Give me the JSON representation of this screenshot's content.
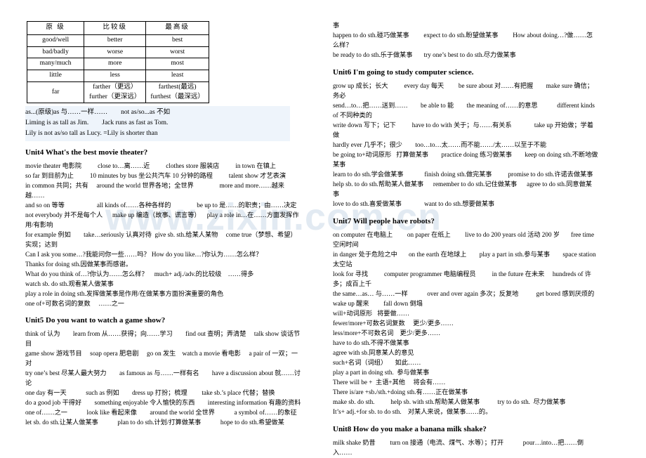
{
  "watermark": {
    "text": "www.zixin.com.cn"
  },
  "grammar_table": {
    "headers": [
      "原 级",
      "比较级",
      "最高级"
    ],
    "rows": [
      [
        "good/well",
        "better",
        "best"
      ],
      [
        "bad/badly",
        "worse",
        "worst"
      ],
      [
        "many/much",
        "more",
        "most"
      ],
      [
        "little",
        "less",
        "least"
      ],
      [
        "far",
        "farther（更远）\nfurther（更深远）",
        "farthest(最远)\nfurthest（最深远）"
      ]
    ]
  },
  "note_block": {
    "lines": [
      "as...(原级)as 与……一样……        not as/so...as 不如",
      "Liming is as tall as Jim.        Jack runs as fast as Tom.",
      "Lily is not as/so tall as Lucy. =Lily is shorter than"
    ]
  },
  "units": {
    "unit4": {
      "heading": "Unit4 What's the best movie theater?",
      "lines": [
        "movie theater 电影院          close to…离……近          clothes store 服装店          in town 在镇上",
        "so far 到目前为止          10 minutes by bus 坐公共汽车 10 分钟的路程          talent show 才艺表演",
        "in common 共同；共有     around the world 世界各地；全世界                more and more……越来越……",
        "and so on 等等                    all kinds of……各种各样的                be up to 是……的职责；由……决定",
        "not everybody 并不是每个人      make up 编造（故事、谎言等）    play a role in…在……方面发挥作用/有影响",
        "for example 例如        take…seriously 认真对待  give sb. sth.给某人某物     come true（梦想、希望）实现；达到",
        "Can I ask you some…?我能问你一些……吗？ How do you like…?你认为……怎么样？",
        "Thanks for doing sth.因做某事而感谢。",
        "What do you think of…?你认为……怎么样？    much+ adj./adv.的比较级    ……得多",
        "watch sb. do sth.观看某人做某事",
        "play a role in doing sth.发挥做某事是作用/在做某事方面扮演重要的角色",
        "one of+可数名词的复数     ……之一"
      ]
    },
    "unit5": {
      "heading": "Unit5 Do you want to watch a game show?",
      "lines": [
        "think of 认为        learn from 从……获得；向……学习        find out 查明；弄清楚     talk show 谈话节目",
        "game show 游戏节目     soap opera 肥皂剧     go on 发生    watch a movie 看电影     a pair of 一双；一对",
        "try one’s best 尽某人最大努力        as famous as 与……一样有名        have a discussion about 就……讨论",
        "one day 有一天            such as 例如        dress up 打扮；梳理         take sb.’s place 代替；替换",
        "do a good job 干得好        something enjoyable 令人愉快的东西        interesting information 有趣的资料",
        "one of……之一            look like 看起来像        around the world 全世界            a symbol of……的象征",
        "let sb. do sth.让某人做某事            plan to do sth.计划/打算做某事            hope to do sth.希望做某"
      ]
    },
    "unit5_cont": {
      "lines": [
        "事",
        "happen to do sth.碰巧做某事         expect to do sth.盼望做某事         How about doing…?做……怎么样？",
        "be ready to do sth.乐于做某事       try one’s best to do sth.尽力做某事"
      ]
    },
    "unit6": {
      "heading": "Unit6 I'm going to study computer science.",
      "lines": [
        "grow up 成长；长大          every day 每天         be sure about 对……有把握        make sure 确信；务必",
        "send…to…把……送到……        be able to 能        the meaning of……的意思            different kinds of 不同种类的",
        "write down 写下；记下          have to do with 关于；与……有关系              take up 开始做；学着做",
        "hardly ever 几乎不；很少        too…to…太……而不能……/太……以至于不能",
        "be going to+动词原形   打算做某事        practice doing 练习做某事        keep on doing sth.不断地做某事",
        "learn to do sth.学会做某事             finish doing sth.做完某事          promise to do sth.许诺去做某事",
        "help sb. to do sth.帮助某人做某事      remember to do sth.记住做某事      agree to do sth.同意做某事",
        "love to do sth.喜爱做某事              want to do sth.想要做某事"
      ]
    },
    "unit7": {
      "heading": "Unit7 Will people have robots?",
      "lines": [
        "on computer 在电脑上         on paper 在纸上         live to do 200 years old 活动 200 岁       free time 空闲时间",
        "in danger 处于危险之中       on the earth 在地球上        play a part in sth.参与某事        space station 太空站",
        "look for 寻找          computer programmer 电脑编程员          in the future 在未来     hundreds of 许多；成百上千",
        "the same…as… 与……一样            over and over again 多次；反复地           get bored 感到厌烦的",
        "wake up 醒来         fall down 倒塌",
        "will+动词原形   将要做……",
        "fewer/more+可数名词复数     更少/更多……",
        "less/more+不可数名词    更少/更多……",
        "have to do sth.不得不做某事",
        "agree with sb.同意某人的意见",
        "such+名词（词组）     如此……",
        "play a part in doing sth.  参与做某事",
        "There will be +  主语+其他     将会有……",
        "There is/are +sb./sth.+doing sth.有……正在做某事",
        "make sb. do sth.          help sb. with sth.帮助某人做某事           try to do sth.  尽力做某事",
        "It’s+ adj.+for sb. to do sth.    对某人来说，做某事……的。"
      ]
    },
    "unit8": {
      "heading": "Unit8 How do you make a banana milk shake?",
      "lines": [
        "milk shake 奶昔         turn on 接通（电流、煤气、水等）；打开            pour…into…把……倒入……"
      ]
    }
  }
}
